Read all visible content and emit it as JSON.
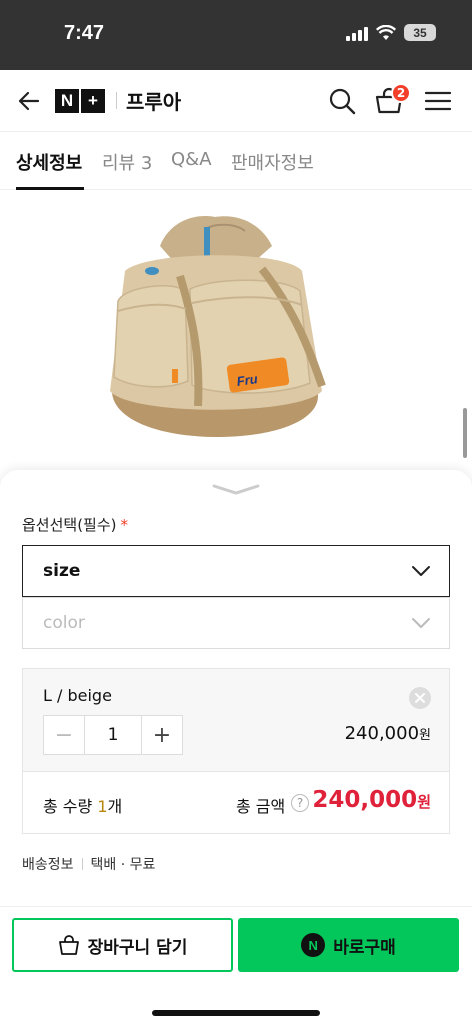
{
  "status_bar": {
    "time": "7:47",
    "battery": "35"
  },
  "header": {
    "logo_n": "N",
    "logo_plus": "+",
    "store_name": "프루아",
    "cart_count": "2"
  },
  "tabs": [
    {
      "label": "상세정보",
      "active": true
    },
    {
      "label": "리뷰 3",
      "active": false
    },
    {
      "label": "Q&A",
      "active": false
    },
    {
      "label": "판매자정보",
      "active": false
    }
  ],
  "product": {
    "bag_patch_text": "Fru"
  },
  "options": {
    "title": "옵션선택(필수)",
    "required_mark": "*",
    "selects": [
      {
        "label": "size",
        "state": "active"
      },
      {
        "label": "color",
        "state": "disabled"
      }
    ]
  },
  "selected_item": {
    "name": "L / beige",
    "quantity": "1",
    "minus": "−",
    "plus": "+",
    "price": "240,000",
    "currency": "원"
  },
  "totals": {
    "qty_prefix": "총 수량 ",
    "qty_value": "1",
    "qty_suffix": "개",
    "amount_label": "총 금액",
    "help": "?",
    "amount": "240,000",
    "currency": "원"
  },
  "shipping": {
    "label": "배송정보",
    "method": "택배 · 무료"
  },
  "buttons": {
    "cart": "장바구니 담기",
    "buy": "바로구매",
    "npay_mark": "N"
  },
  "colors": {
    "naver_green": "#03c75a",
    "price_red": "#e0213a",
    "badge_red": "#f33e2a"
  }
}
